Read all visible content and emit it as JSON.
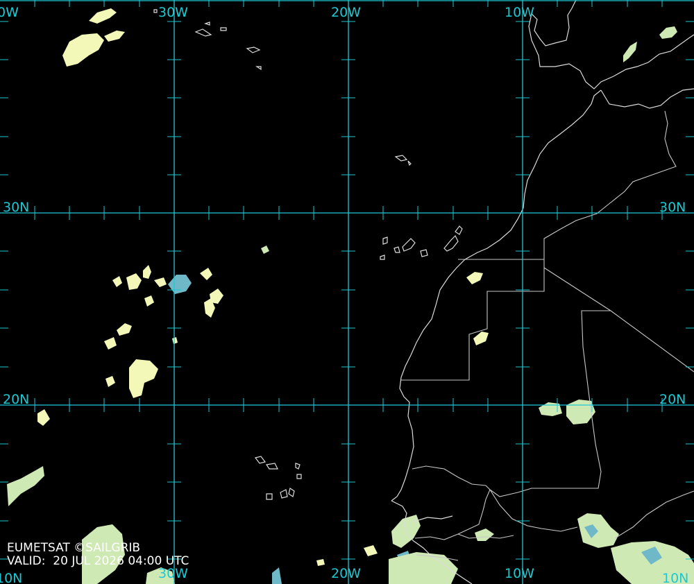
{
  "map": {
    "longitude_labels": [
      "30W",
      "20W",
      "10W"
    ],
    "latitude_labels": [
      "30N",
      "20N"
    ],
    "edge_fragments": {
      "top_left": "0W",
      "bottom_left": "10N",
      "bottom_right": "10N"
    },
    "colors": {
      "background": "#000000",
      "graticule": "#1ec8d2",
      "coastline": "#dcdcdc",
      "cloud_light": "#f3f7b8",
      "cloud_mid": "#cfe9b4",
      "cloud_cold": "#6fb8c8"
    }
  },
  "credit": {
    "source": "EUMETSAT ©SAILGRIB",
    "valid": "VALID:  20 JUL 2026 04:00 UTC"
  }
}
